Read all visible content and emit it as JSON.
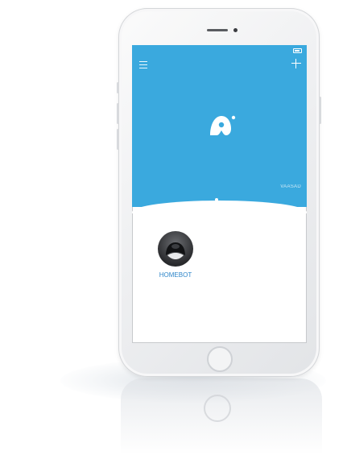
{
  "screen": {
    "status_bar": {
      "carrier": "",
      "time": "",
      "battery": ""
    },
    "header": {
      "brand_caption": "VAASAD",
      "accent_color": "#3aa9de",
      "menu_icon": "hamburger-menu-icon",
      "add_icon": "plus-icon",
      "logo_icon": "app-logo-icon"
    },
    "devices": [
      {
        "name": "HOMEBOT",
        "icon": "robot-vacuum-icon"
      }
    ]
  }
}
